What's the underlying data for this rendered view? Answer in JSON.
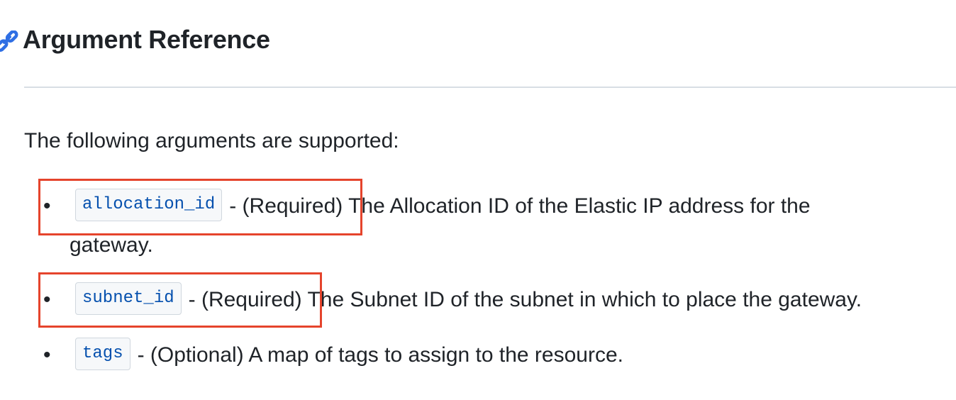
{
  "section": {
    "title": "Argument Reference",
    "intro": "The following arguments are supported:"
  },
  "arguments": [
    {
      "name": "allocation_id",
      "requirement": "- (Required)",
      "description": "The Allocation ID of the Elastic IP address for the gateway.",
      "highlighted": true
    },
    {
      "name": "subnet_id",
      "requirement": "- (Required)",
      "description": "The Subnet ID of the subnet in which to place the gateway.",
      "highlighted": true
    },
    {
      "name": "tags",
      "requirement": "- (Optional)",
      "description": "A map of tags to assign to the resource.",
      "highlighted": false
    }
  ],
  "icons": {
    "anchor": "link-icon"
  },
  "colors": {
    "text": "#1f2328",
    "code_text": "#0550ae",
    "code_bg": "#f6f8fa",
    "link": "#2f6fe4",
    "highlight": "#e5442c",
    "divider": "#d8dee4"
  }
}
